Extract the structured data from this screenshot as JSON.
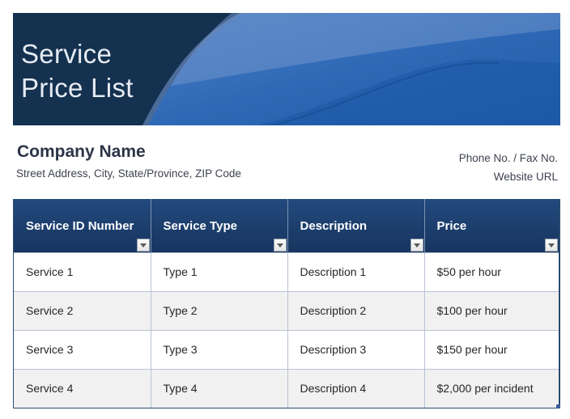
{
  "banner": {
    "title_line1": "Service",
    "title_line2": "Price List"
  },
  "company": {
    "name": "Company Name",
    "address": "Street Address, City, State/Province, ZIP Code",
    "phone_fax": "Phone No. / Fax No.",
    "website": "Website URL"
  },
  "table": {
    "headers": [
      {
        "label": "Service ID Number",
        "filter_icon": "dropdown-arrow-icon"
      },
      {
        "label": "Service Type",
        "filter_icon": "dropdown-arrow-icon"
      },
      {
        "label": "Description",
        "filter_icon": "dropdown-arrow-icon"
      },
      {
        "label": "Price",
        "filter_icon": "dropdown-arrow-icon"
      }
    ],
    "rows": [
      [
        "Service 1",
        "Type 1",
        "Description 1",
        "$50 per hour"
      ],
      [
        "Service 2",
        "Type 2",
        "Description 2",
        "$100 per hour"
      ],
      [
        "Service 3",
        "Type 3",
        "Description 3",
        "$150 per hour"
      ],
      [
        "Service 4",
        "Type 4",
        "Description 4",
        "$2,000 per incident"
      ]
    ]
  },
  "colors": {
    "banner_dark": "#14314f",
    "banner_blue": "#2e6bb8",
    "header_navy": "#1c3e6c",
    "row_alt": "#f1f1f1",
    "grid_line": "#b9c2d3",
    "company_text": "#2c3447"
  }
}
